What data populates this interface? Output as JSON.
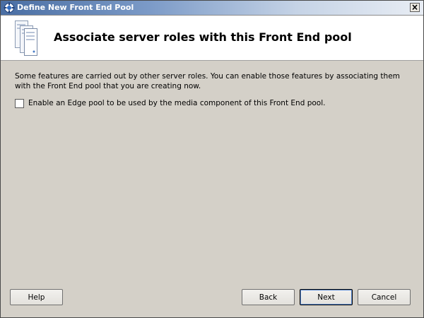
{
  "window": {
    "title": "Define New Front End Pool",
    "close_label": "×"
  },
  "header": {
    "title": "Associate server roles with this Front End pool"
  },
  "content": {
    "description": "Some features are carried out by other server roles. You can enable those features by associating them with the Front End pool that you are creating now.",
    "edge_pool_checkbox": {
      "label": "Enable an Edge pool to be used by the media component of this Front End pool.",
      "checked": false
    }
  },
  "buttons": {
    "help": "Help",
    "back": "Back",
    "next": "Next",
    "cancel": "Cancel"
  }
}
